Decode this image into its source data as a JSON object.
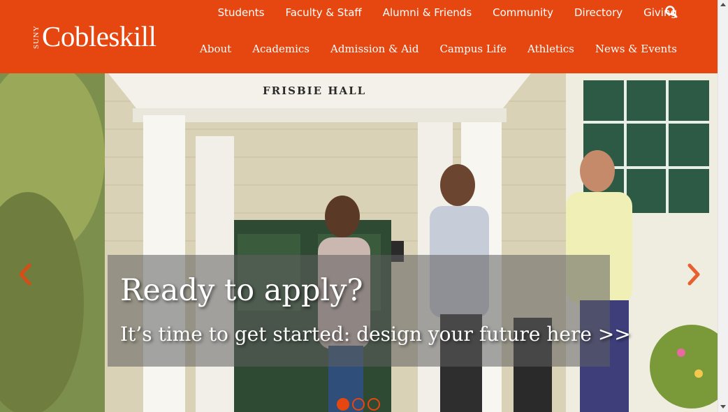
{
  "brand": {
    "suny": "SUNY",
    "name": "Cobleskill",
    "accent_color": "#e64711"
  },
  "utility_nav": [
    {
      "label": "Students"
    },
    {
      "label": "Faculty & Staff"
    },
    {
      "label": "Alumni & Friends"
    },
    {
      "label": "Community"
    },
    {
      "label": "Directory"
    },
    {
      "label": "Giving"
    }
  ],
  "search": {
    "icon": "search-icon"
  },
  "main_nav": [
    {
      "label": "About"
    },
    {
      "label": "Academics"
    },
    {
      "label": "Admission & Aid"
    },
    {
      "label": "Campus Life"
    },
    {
      "label": "Athletics"
    },
    {
      "label": "News & Events"
    }
  ],
  "hero": {
    "building_sign": "FRISBIE HALL",
    "caption_title": "Ready to apply?",
    "caption_link": "It’s time to get started: design your future here >>",
    "prev_icon": "chevron-left-icon",
    "next_icon": "chevron-right-icon",
    "slides": [
      {
        "active": true
      },
      {
        "active": false
      },
      {
        "active": false
      }
    ]
  }
}
